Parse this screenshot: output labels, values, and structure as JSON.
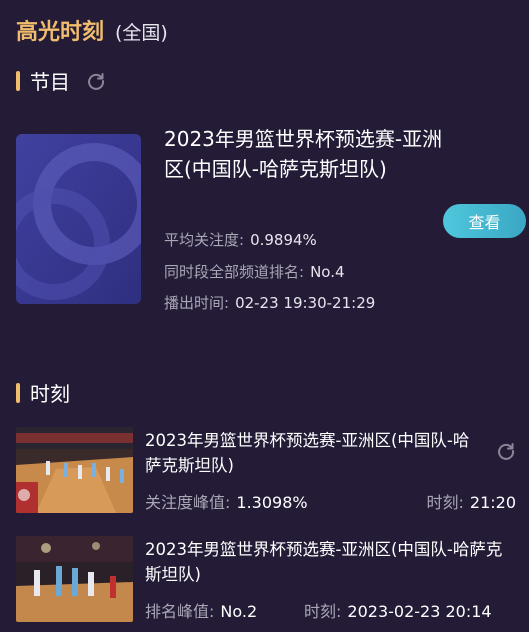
{
  "header": {
    "title": "高光时刻",
    "scope": "(全国)"
  },
  "program_section": {
    "label": "节目",
    "program": {
      "title": "2023年男篮世界杯预选赛-亚洲区(中国队-哈萨克斯坦队)",
      "avg_attention_label": "平均关注度:",
      "avg_attention_value": "0.9894%",
      "rank_label": "同时段全部频道排名:",
      "rank_value": "No.4",
      "air_time_label": "播出时间:",
      "air_time_value": "02-23 19:30-21:29",
      "view_button": "查看"
    }
  },
  "moments_section": {
    "label": "时刻",
    "items": [
      {
        "title": "2023年男篮世界杯预选赛-亚洲区(中国队-哈萨克斯坦队)",
        "metric_label": "关注度峰值:",
        "metric_value": "1.3098%",
        "time_label": "时刻:",
        "time_value": "21:20"
      },
      {
        "title": "2023年男篮世界杯预选赛-亚洲区(中国队-哈萨克斯坦队)",
        "metric_label": "排名峰值:",
        "metric_value": "No.2",
        "time_label": "时刻:",
        "time_value": "2023-02-23 20:14"
      }
    ]
  },
  "colors": {
    "background": "#241c37",
    "accent": "#f0bc6e",
    "button": "#4fc7dc",
    "muted_text": "#aaa6b6"
  }
}
